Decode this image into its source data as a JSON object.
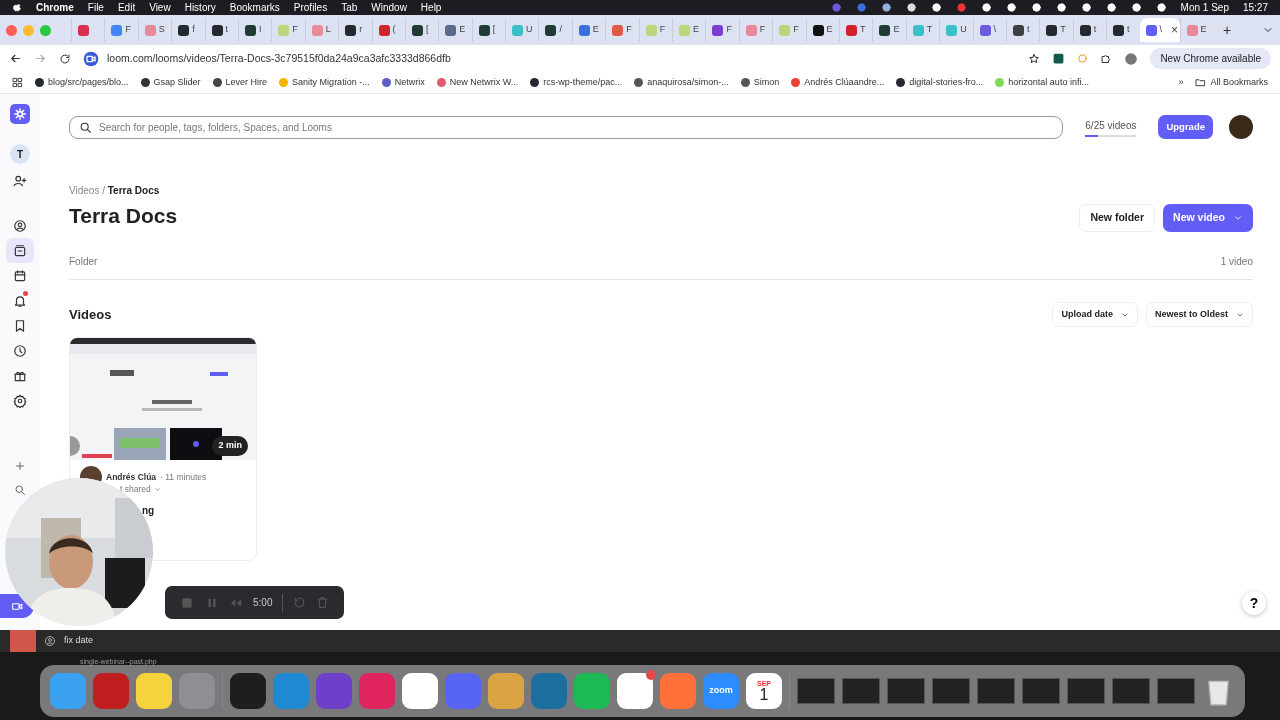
{
  "menu_bar": {
    "app": "Chrome",
    "menus": [
      "File",
      "Edit",
      "View",
      "History",
      "Bookmarks",
      "Profiles",
      "Tab",
      "Window",
      "Help"
    ],
    "date": "Mon 1 Sep",
    "time": "15:27"
  },
  "tabs": [
    {
      "color": "#d9304f",
      "selected": false
    },
    {
      "color": "#4285f4",
      "label": "F",
      "selected": false
    },
    {
      "color": "#e88a9a",
      "label": "S",
      "selected": false
    },
    {
      "color": "#24292f",
      "label": "f",
      "selected": false
    },
    {
      "color": "#24292f",
      "label": "t",
      "selected": false
    },
    {
      "color": "#1f3b33",
      "label": "I",
      "selected": false
    },
    {
      "color": "#b9d77a",
      "label": "F",
      "selected": false
    },
    {
      "color": "#e88a9a",
      "label": "L",
      "selected": false
    },
    {
      "color": "#24292f",
      "label": "r",
      "selected": false
    },
    {
      "color": "#d0242b",
      "label": "(",
      "selected": false
    },
    {
      "color": "#1f3b33",
      "label": "[",
      "selected": false
    },
    {
      "color": "#5b6b8c",
      "label": "E",
      "selected": false
    },
    {
      "color": "#1f3b33",
      "label": "[",
      "selected": false
    },
    {
      "color": "#3cc0c8",
      "label": "U",
      "selected": false
    },
    {
      "color": "#1f3b33",
      "label": "/",
      "selected": false
    },
    {
      "color": "#3b6fe0",
      "label": "E",
      "selected": false
    },
    {
      "color": "#e05a4a",
      "label": "F",
      "selected": false
    },
    {
      "color": "#b9d77a",
      "label": "F",
      "selected": false
    },
    {
      "color": "#b9d77a",
      "label": "E",
      "selected": false
    },
    {
      "color": "#7a3fd0",
      "label": "F",
      "selected": false
    },
    {
      "color": "#e88a9a",
      "label": "F",
      "selected": false
    },
    {
      "color": "#b9d77a",
      "label": "F",
      "selected": false
    },
    {
      "color": "#111111",
      "label": "E",
      "selected": false
    },
    {
      "color": "#d0242b",
      "label": "T",
      "selected": false
    },
    {
      "color": "#1f3b33",
      "label": "E",
      "selected": false
    },
    {
      "color": "#3cc0c8",
      "label": "T",
      "selected": false
    },
    {
      "color": "#3cc0c8",
      "label": "U",
      "selected": false
    },
    {
      "color": "#6a5be0",
      "label": "\\",
      "selected": false
    },
    {
      "color": "#3c4043",
      "label": "t",
      "selected": false
    },
    {
      "color": "#24292f",
      "label": "T",
      "selected": false
    },
    {
      "color": "#24292f",
      "label": "t",
      "selected": false
    },
    {
      "color": "#24292f",
      "label": "t",
      "selected": false
    },
    {
      "color": "#625df5",
      "label": "\\",
      "selected": true,
      "close": "×"
    },
    {
      "color": "#e88a9a",
      "label": "E",
      "selected": false
    }
  ],
  "new_tab": "+",
  "address_bar": {
    "url": "loom.com/looms/videos/Terra-Docs-3c79515f0da24a9ca3afc3333d866dfb",
    "update_label": "New Chrome available"
  },
  "bookmarks": [
    {
      "label": "blog/src/pages/blo...",
      "color": "#24292f"
    },
    {
      "label": "Gsap Slider",
      "color": "#333333"
    },
    {
      "label": "Lever Hire",
      "color": "#444444"
    },
    {
      "label": "Sanity Migration -...",
      "color": "#f4b400"
    },
    {
      "label": "Netwrix",
      "color": "#5b5fc7"
    },
    {
      "label": "New Netwrix W...",
      "color": "#e05a6a"
    },
    {
      "label": "rcs-wp-theme/pac...",
      "color": "#24292f"
    },
    {
      "label": "anaquirosa/simon-...",
      "color": "#555555"
    },
    {
      "label": "Simon",
      "color": "#555555"
    },
    {
      "label": "Andrés Clúaandre...",
      "color": "#ea4335"
    },
    {
      "label": "digital-stories-fro...",
      "color": "#24292f"
    },
    {
      "label": "horizontal auto infi...",
      "color": "#7ed957"
    }
  ],
  "bookmarks_more": "»",
  "all_bookmarks": "All Bookmarks",
  "sidebar": {
    "avatar": "T",
    "items": [
      {
        "kind": "profile",
        "selected": false,
        "badge": false
      },
      {
        "kind": "library",
        "selected": true,
        "badge": false
      },
      {
        "kind": "calendar",
        "selected": false,
        "badge": false
      },
      {
        "kind": "bell",
        "selected": false,
        "badge": true
      },
      {
        "kind": "bookmark",
        "selected": false,
        "badge": false
      },
      {
        "kind": "clock",
        "selected": false,
        "badge": false
      },
      {
        "kind": "gift",
        "selected": false,
        "badge": false
      },
      {
        "kind": "gear",
        "selected": false,
        "badge": false
      }
    ]
  },
  "search": {
    "placeholder": "Search for people, tags, folders, Spaces, and Looms"
  },
  "usage": {
    "label": "6/25 videos",
    "level": 0.24
  },
  "upgrade_button": "Upgrade",
  "breadcrumb": {
    "parent": "Videos",
    "separator": "/",
    "current": "Terra Docs"
  },
  "title": "Terra Docs",
  "new_folder_button": "New folder",
  "new_video_button": "New video",
  "subtitle": "Folder",
  "count": "1 video",
  "section_title": "Videos",
  "sorts": [
    "Upload date",
    "Newest to Oldest"
  ],
  "videos": [
    {
      "duration": "2 min",
      "author": "Andrés Clúa",
      "age": "· 11 minutes",
      "sharing": "t shared",
      "title": "ng"
    }
  ],
  "recorder": {
    "time": "5:00"
  },
  "help": "?",
  "editor_strip": {
    "commit": "fix date",
    "file": "single-webinar--past.php"
  },
  "dock": [
    {
      "kind": "app",
      "color": "#3aa0f0"
    },
    {
      "kind": "app",
      "color": "#bf1e1e"
    },
    {
      "kind": "app",
      "color": "#f5d33d"
    },
    {
      "kind": "app",
      "color": "#8e8e93"
    },
    {
      "kind": "app",
      "color": "#1e1e1e"
    },
    {
      "kind": "app",
      "color": "#1f8ad2"
    },
    {
      "kind": "app",
      "color": "#6e40c9"
    },
    {
      "kind": "app",
      "color": "#e0245e"
    },
    {
      "kind": "app",
      "color": "#ffffff"
    },
    {
      "kind": "app",
      "color": "#5865f2"
    },
    {
      "kind": "app",
      "color": "#d9a441"
    },
    {
      "kind": "app",
      "color": "#1b6fa0"
    },
    {
      "kind": "app",
      "color": "#1db954"
    },
    {
      "kind": "app",
      "color": "#ffffff",
      "badge": true
    },
    {
      "kind": "app",
      "color": "#ff7139"
    },
    {
      "kind": "app",
      "color": "#2d8cff",
      "label": "zoom"
    },
    {
      "kind": "calendar",
      "month": "SEP",
      "day": "1"
    },
    {
      "kind": "window"
    },
    {
      "kind": "window"
    },
    {
      "kind": "window"
    },
    {
      "kind": "window"
    },
    {
      "kind": "window"
    },
    {
      "kind": "window"
    },
    {
      "kind": "window"
    },
    {
      "kind": "window"
    },
    {
      "kind": "window"
    },
    {
      "kind": "trash"
    }
  ]
}
